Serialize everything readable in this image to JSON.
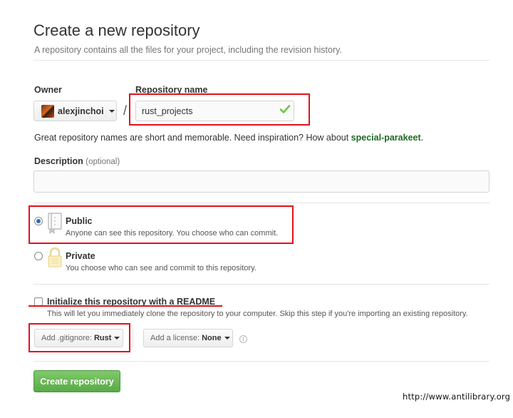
{
  "header": {
    "title": "Create a new repository",
    "subtitle": "A repository contains all the files for your project, including the revision history."
  },
  "owner": {
    "label": "Owner",
    "value": "alexjinchoi"
  },
  "repository_name": {
    "label": "Repository name",
    "value": "rust_projects",
    "separator": "/"
  },
  "name_hint": {
    "text": "Great repository names are short and memorable. Need inspiration? How about ",
    "suggestion": "special-parakeet",
    "end": "."
  },
  "description": {
    "label": "Description",
    "optional": "(optional)",
    "value": ""
  },
  "visibility": {
    "selected": "public",
    "public": {
      "title": "Public",
      "desc": "Anyone can see this repository. You choose who can commit."
    },
    "private": {
      "title": "Private",
      "desc": "You choose who can see and commit to this repository."
    }
  },
  "readme": {
    "label": "Initialize this repository with a README",
    "desc": "This will let you immediately clone the repository to your computer. Skip this step if you're importing an existing repository.",
    "checked": false
  },
  "gitignore": {
    "prefix": "Add .gitignore:",
    "value": "Rust"
  },
  "license": {
    "prefix": "Add a license:",
    "value": "None"
  },
  "info_icon": "i",
  "create_button": "Create repository",
  "watermark": "http://www.antilibrary.org",
  "colors": {
    "accent_green": "#5aaa47",
    "suggestion_green": "#1e6823",
    "highlight_red": "#e0121b",
    "radio_blue": "#2a6ebd"
  },
  "icons": {
    "owner_avatar": "avatar",
    "owner_dropdown": "caret-down-icon",
    "name_valid": "checkmark-icon",
    "public": "book-icon",
    "private": "lock-icon",
    "license_info": "info-icon"
  }
}
